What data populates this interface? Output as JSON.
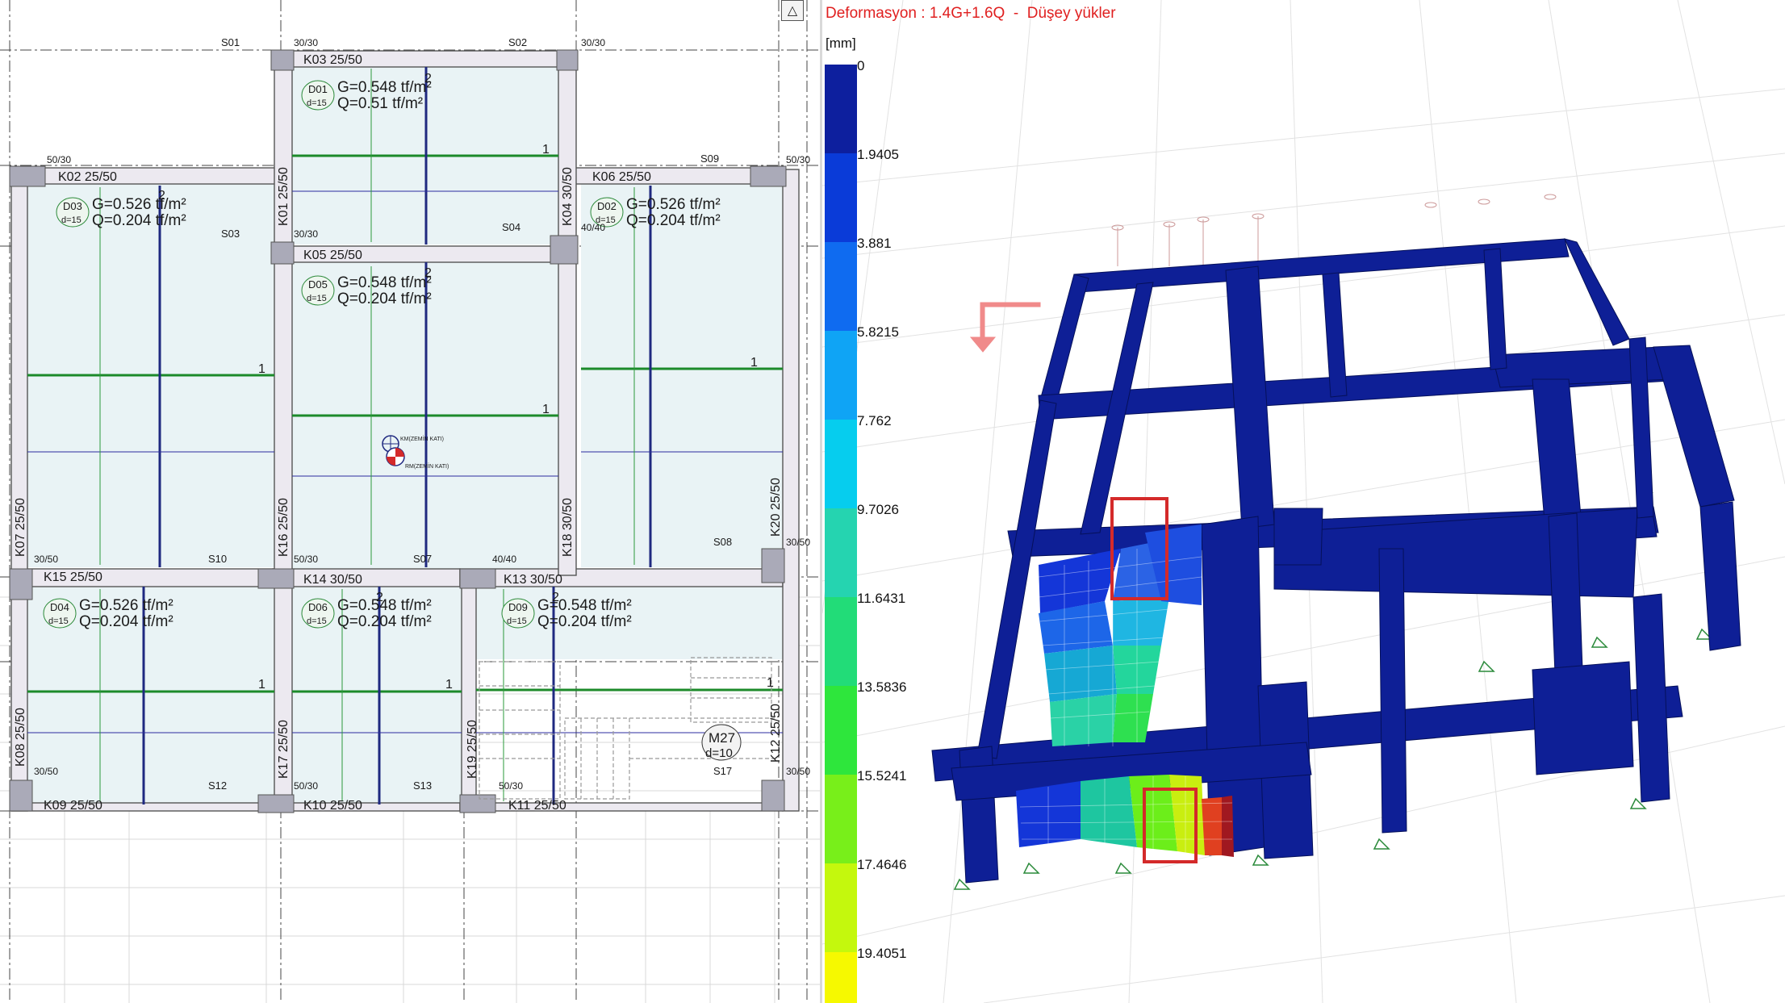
{
  "plan": {
    "slabs": [
      {
        "id": "D01",
        "d": "d=15",
        "g": "G=0.548 tf/m²",
        "q": "Q=0.51 tf/m²"
      },
      {
        "id": "D03",
        "d": "d=15",
        "g": "G=0.526 tf/m²",
        "q": "Q=0.204 tf/m²"
      },
      {
        "id": "D02",
        "d": "d=15",
        "g": "G=0.526 tf/m²",
        "q": "Q=0.204 tf/m²"
      },
      {
        "id": "D05",
        "d": "d=15",
        "g": "G=0.548 tf/m²",
        "q": "Q=0.204 tf/m²"
      },
      {
        "id": "D04",
        "d": "d=15",
        "g": "G=0.526 tf/m²",
        "q": "Q=0.204 tf/m²"
      },
      {
        "id": "D06",
        "d": "d=15",
        "g": "G=0.548 tf/m²",
        "q": "Q=0.204 tf/m²"
      },
      {
        "id": "D09",
        "d": "d=15",
        "g": "G=0.548 tf/m²",
        "q": "Q=0.204 tf/m²"
      }
    ],
    "beams": [
      {
        "label": "K03   25/50"
      },
      {
        "label": "K02   25/50"
      },
      {
        "label": "K06   25/50"
      },
      {
        "label": "K05   25/50"
      },
      {
        "label": "K15   25/50"
      },
      {
        "label": "K14   30/50"
      },
      {
        "label": "K13   30/50"
      },
      {
        "label": "K09   25/50"
      },
      {
        "label": "K10   25/50"
      },
      {
        "label": "K11   25/50"
      },
      {
        "label": "K01   25/50"
      },
      {
        "label": "K04   30/50"
      },
      {
        "label": "K07   25/50"
      },
      {
        "label": "K16   25/50"
      },
      {
        "label": "K18   30/50"
      },
      {
        "label": "K20   25/50"
      },
      {
        "label": "K08   25/50"
      },
      {
        "label": "K17   25/50"
      },
      {
        "label": "K19   25/50"
      },
      {
        "label": "K12   25/50"
      }
    ],
    "columns": [
      {
        "id": "S01"
      },
      {
        "id": "S02"
      },
      {
        "id": "S09"
      },
      {
        "id": "S03"
      },
      {
        "id": "S04"
      },
      {
        "id": "S10"
      },
      {
        "id": "S07"
      },
      {
        "id": "S08"
      },
      {
        "id": "S12"
      },
      {
        "id": "S13"
      },
      {
        "id": "S17"
      }
    ],
    "column_sizes": [
      "30/30",
      "30/30",
      "50/30",
      "50/30",
      "30/30",
      "40/40",
      "30/50",
      "50/30",
      "40/40",
      "30/50",
      "30/50",
      "50/30",
      "50/30",
      "30/50"
    ],
    "stair": {
      "id": "M27",
      "d": "d=10"
    },
    "center_marks": {
      "km": "KM(ZEMİN KATI)",
      "rm": "RM(ZEMİN KATI)"
    },
    "span_marks": [
      "1",
      "2"
    ]
  },
  "view": {
    "title": "Deformasyon : 1.4G+1.6Q  -  Düşey yükler",
    "collapse_symbol": "△",
    "legend_unit": "[mm]",
    "legend_labels": [
      "0",
      "1.9405",
      "3.881",
      "5.8215",
      "7.762",
      "9.7026",
      "11.6431",
      "13.5836",
      "15.5241",
      "17.4646",
      "19.4051"
    ],
    "legend_colors": [
      "#0d1f9e",
      "#0a3bd8",
      "#0f6bf0",
      "#0fa4f5",
      "#06cdee",
      "#25d4b0",
      "#22dc78",
      "#2ee63c",
      "#78ef1a",
      "#c4f80d",
      "#f6f900"
    ],
    "highlight_color": "#d42a2a",
    "frame_color": "#0e1f96"
  }
}
